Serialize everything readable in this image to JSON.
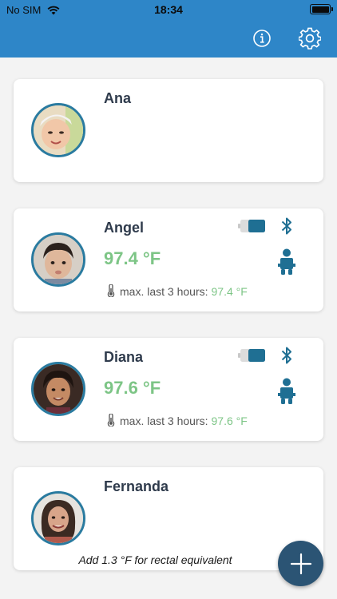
{
  "status_bar": {
    "carrier": "No SIM",
    "time": "18:34"
  },
  "header": {
    "info_icon": "info-icon",
    "settings_icon": "gear-icon"
  },
  "colors": {
    "header_blue": "#2e86c8",
    "avatar_ring": "#2a7ba0",
    "temperature_green": "#7dc586",
    "icon_blue": "#1f6f93",
    "fab": "#2b5474"
  },
  "children": [
    {
      "name": "Ana"
    },
    {
      "name": "Angel",
      "temperature": "97.4 °F",
      "max_label": "max. last 3 hours:",
      "max_value": "97.4 °F"
    },
    {
      "name": "Diana",
      "temperature": "97.6 °F",
      "max_label": "max. last 3 hours:",
      "max_value": "97.6 °F"
    },
    {
      "name": "Fernanda"
    }
  ],
  "footnote": "Add 1.3 °F for rectal equivalent",
  "add_button_icon": "plus-icon"
}
